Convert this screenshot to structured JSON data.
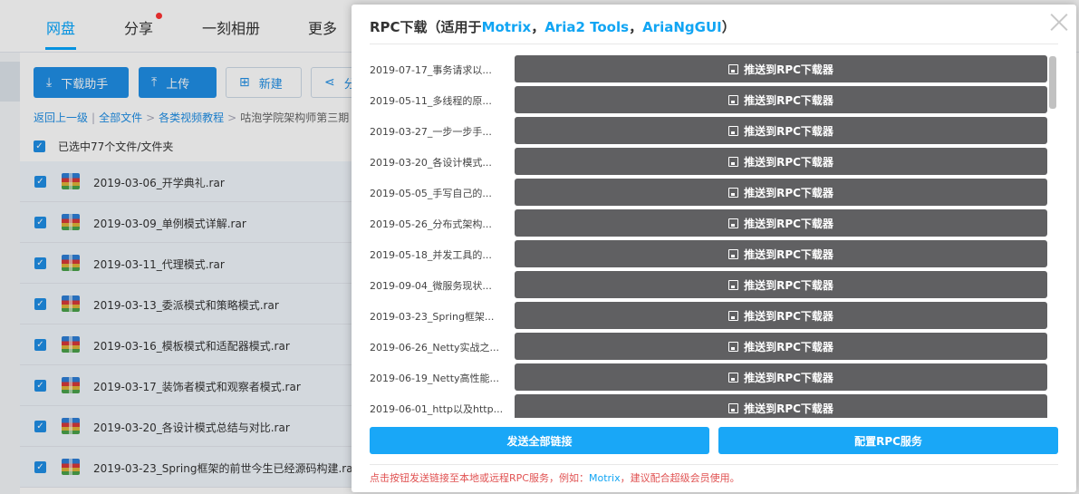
{
  "topnav": {
    "tabs": [
      {
        "label": "网盘"
      },
      {
        "label": "分享"
      },
      {
        "label": "一刻相册"
      },
      {
        "label": "更多"
      }
    ]
  },
  "toolbar": {
    "download_helper": "下载助手",
    "upload": "上传",
    "new": "新建",
    "share": "分"
  },
  "breadcrumb": {
    "back": "返回上一级",
    "sep1": "|",
    "all_files": "全部文件",
    "sep2": ">",
    "category": "各类视频教程",
    "sep3": ">",
    "current": "咕泡学院架构师第三期"
  },
  "selection": {
    "label": "已选中77个文件/文件夹"
  },
  "files": [
    {
      "name": "2019-03-06_开学典礼.rar"
    },
    {
      "name": "2019-03-09_单例模式详解.rar"
    },
    {
      "name": "2019-03-11_代理模式.rar"
    },
    {
      "name": "2019-03-13_委派模式和策略模式.rar"
    },
    {
      "name": "2019-03-16_模板模式和适配器模式.rar"
    },
    {
      "name": "2019-03-17_装饰者模式和观察者模式.rar"
    },
    {
      "name": "2019-03-20_各设计模式总结与对比.rar"
    },
    {
      "name": "2019-03-23_Spring框架的前世今生已经源码构建.rar"
    }
  ],
  "dialog": {
    "title_prefix": "RPC下载（适用于",
    "app1": "Motrix",
    "comma1": "，",
    "app2": "Aria2 Tools",
    "comma2": "，",
    "app3": "AriaNgGUI",
    "title_suffix": "）",
    "push_label": "推送到RPC下载器",
    "rows": [
      {
        "name": "2019-07-17_事务请求以..."
      },
      {
        "name": "2019-05-11_多线程的原..."
      },
      {
        "name": "2019-03-27_一步一步手..."
      },
      {
        "name": "2019-03-20_各设计模式..."
      },
      {
        "name": "2019-05-05_手写自己的..."
      },
      {
        "name": "2019-05-26_分布式架构..."
      },
      {
        "name": "2019-05-18_并发工具的..."
      },
      {
        "name": "2019-09-04_微服务现状..."
      },
      {
        "name": "2019-03-23_Spring框架..."
      },
      {
        "name": "2019-06-26_Netty实战之..."
      },
      {
        "name": "2019-06-19_Netty高性能..."
      },
      {
        "name": "2019-06-01_http以及http..."
      }
    ],
    "send_all": "发送全部链接",
    "configure": "配置RPC服务",
    "note_prefix": "点击按钮发送链接至本地或远程RPC服务，例如：",
    "note_app": "Motrix",
    "note_suffix": "，建议配合超级会员使用。"
  },
  "colors": {
    "accent": "#11a5f3",
    "push_button": "#606062",
    "note_red": "#e05252"
  }
}
